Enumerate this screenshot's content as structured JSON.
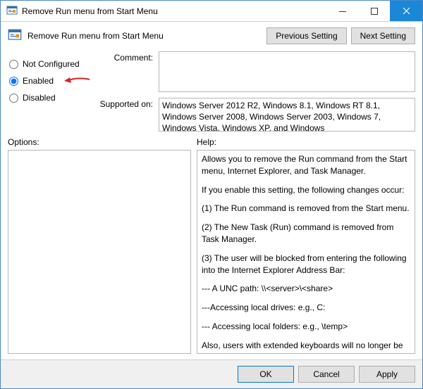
{
  "window": {
    "title": "Remove Run menu from Start Menu"
  },
  "header": {
    "title": "Remove Run menu from Start Menu",
    "previous_btn": "Previous Setting",
    "next_btn": "Next Setting"
  },
  "radios": {
    "not_configured": "Not Configured",
    "enabled": "Enabled",
    "disabled": "Disabled",
    "selected": "enabled"
  },
  "comment": {
    "label": "Comment:",
    "value": ""
  },
  "supported": {
    "label": "Supported on:",
    "text": "Windows Server 2012 R2, Windows 8.1, Windows RT 8.1, Windows Server 2008, Windows Server 2003, Windows 7, Windows Vista, Windows XP, and Windows"
  },
  "options": {
    "label": "Options:"
  },
  "help": {
    "label": "Help:",
    "p1": "Allows you to remove the Run command from the Start menu, Internet Explorer, and Task Manager.",
    "p2": "If you enable this setting, the following changes occur:",
    "p3": "(1) The Run command is removed from the Start menu.",
    "p4": "(2) The New Task (Run) command is removed from Task Manager.",
    "p5": "(3) The user will be blocked from entering the following into the Internet Explorer Address Bar:",
    "p6": "--- A UNC path: \\\\<server>\\<share>",
    "p7": "---Accessing local drives:  e.g., C:",
    "p8": "--- Accessing local folders: e.g., \\temp>",
    "p9": "Also, users with extended keyboards will no longer be able to display the Run dialog box by pressing the Application key (the"
  },
  "footer": {
    "ok": "OK",
    "cancel": "Cancel",
    "apply": "Apply"
  }
}
